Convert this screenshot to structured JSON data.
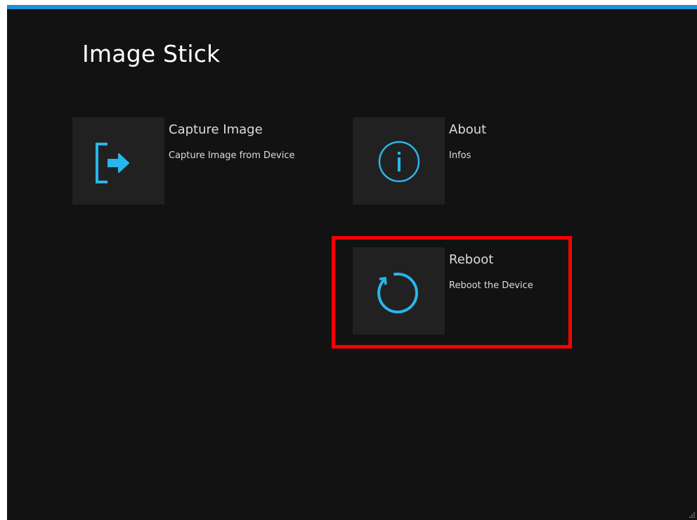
{
  "app": {
    "title": "Image Stick",
    "accent_color": "#1f8fd6",
    "background_color": "#121212",
    "highlight_color": "#ff0000"
  },
  "tiles": [
    {
      "title": "Capture Image",
      "description": "Capture Image from Device",
      "icon": "exit-arrow-icon",
      "icon_color": "#29b6ec"
    },
    {
      "title": "About",
      "description": "Infos",
      "icon": "info-icon",
      "icon_color": "#29b6ec"
    },
    {
      "title": "Reboot",
      "description": "Reboot the Device",
      "icon": "restart-icon",
      "icon_color": "#29b6ec",
      "highlighted": true
    }
  ]
}
